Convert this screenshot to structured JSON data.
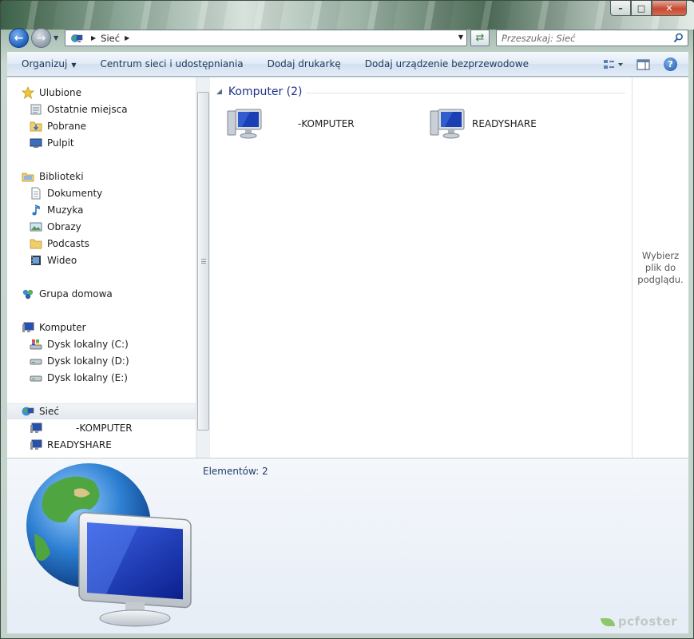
{
  "window": {
    "caption_min": "–",
    "caption_max": "□",
    "caption_close": "✕"
  },
  "address_bar": {
    "path": "Sieć",
    "search_placeholder": "Przeszukaj: Sieć"
  },
  "toolbar": {
    "organize": "Organizuj",
    "items": [
      "Centrum sieci i udostępniania",
      "Dodaj drukarkę",
      "Dodaj urządzenie bezprzewodowe"
    ]
  },
  "nav": {
    "favorites": {
      "label": "Ulubione",
      "items": [
        "Ostatnie miejsca",
        "Pobrane",
        "Pulpit"
      ]
    },
    "libraries": {
      "label": "Biblioteki",
      "items": [
        "Dokumenty",
        "Muzyka",
        "Obrazy",
        "Podcasts",
        "Wideo"
      ]
    },
    "homegroup": {
      "label": "Grupa domowa"
    },
    "computer": {
      "label": "Komputer",
      "items": [
        "Dysk lokalny (C:)",
        "Dysk lokalny (D:)",
        "Dysk lokalny (E:)"
      ]
    },
    "network": {
      "label": "Sieć",
      "items": [
        "-KOMPUTER",
        "READYSHARE"
      ]
    }
  },
  "content": {
    "group_title": "Komputer (2)",
    "items": [
      {
        "name": "-KOMPUTER"
      },
      {
        "name": "READYSHARE"
      }
    ]
  },
  "preview_pane": {
    "text": "Wybierz plik do podglądu."
  },
  "details": {
    "count": "Elementów: 2"
  },
  "watermark": "pcfoster",
  "colors": {
    "accent": "#1e3287",
    "command_text": "#1e395b",
    "monitor_screen": "#1b3fb4"
  }
}
